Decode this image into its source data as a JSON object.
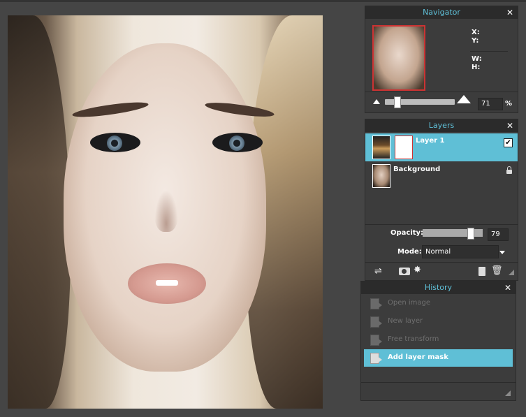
{
  "navigator": {
    "title": "Navigator",
    "close_label": "✕",
    "x_label": "X:",
    "y_label": "Y:",
    "w_label": "W:",
    "h_label": "H:",
    "zoom_value": "71",
    "zoom_unit": "%",
    "zoom_slider_fraction": 0.17
  },
  "layers": {
    "title": "Layers",
    "close_label": "✕",
    "items": [
      {
        "name": "Layer 1",
        "selected": true,
        "visible_check": "✔"
      },
      {
        "name": "Background",
        "selected": false,
        "locked": true
      }
    ],
    "opacity_label": "Opacity:",
    "opacity_value": "79",
    "opacity_fraction": 0.79,
    "mode_label": "Mode:",
    "mode_value": "Normal"
  },
  "history": {
    "title": "History",
    "close_label": "✕",
    "items": [
      {
        "label": "Open image",
        "active": false
      },
      {
        "label": "New layer",
        "active": false
      },
      {
        "label": "Free transform",
        "active": false
      },
      {
        "label": "Add layer mask",
        "active": true
      }
    ]
  },
  "colors": {
    "accent": "#5fbfd6",
    "panel": "#3c3c3c",
    "header": "#2b2b2b",
    "workspace": "#454545"
  },
  "icons": {
    "layer_settings": "sliders-icon",
    "mask": "mask-icon",
    "effects": "effects-icon",
    "new_layer": "new-layer-icon",
    "delete": "trash-icon",
    "lock": "lock-icon"
  }
}
